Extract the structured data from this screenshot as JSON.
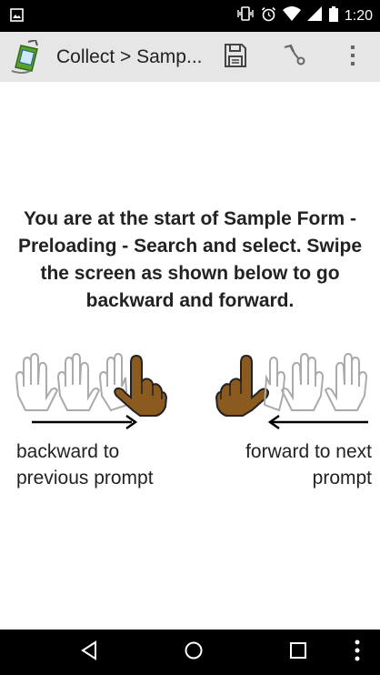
{
  "status_bar": {
    "time": "1:20",
    "icons": [
      "image-notification-icon",
      "vibrate-icon",
      "alarm-icon",
      "wifi-icon",
      "signal-icon",
      "battery-icon"
    ]
  },
  "action_bar": {
    "title": "Collect > Samp...",
    "app_icon": "collect-app-icon",
    "save_icon": "save-icon",
    "navigation_icon": "form-hierarchy-icon",
    "more_icon": "overflow-menu-icon"
  },
  "content": {
    "intro_text": "You are at the start of Sample Form - Preloading - Search and select. Swipe the screen as shown below to go backward and forward.",
    "backward_hint": "backward to previous prompt",
    "forward_hint": "forward to next prompt",
    "swipe_left_icon": "swipe-backward-icon",
    "swipe_right_icon": "swipe-forward-icon"
  },
  "navigation_bar": {
    "back_icon": "back-triangle-icon",
    "home_icon": "home-circle-icon",
    "recents_icon": "recents-square-icon",
    "menu_icon": "menu-dots-icon"
  },
  "colors": {
    "action_bar_bg": "#e6e6e6",
    "hand_fill": "#8a5a1e",
    "system_bars": "#000000"
  }
}
